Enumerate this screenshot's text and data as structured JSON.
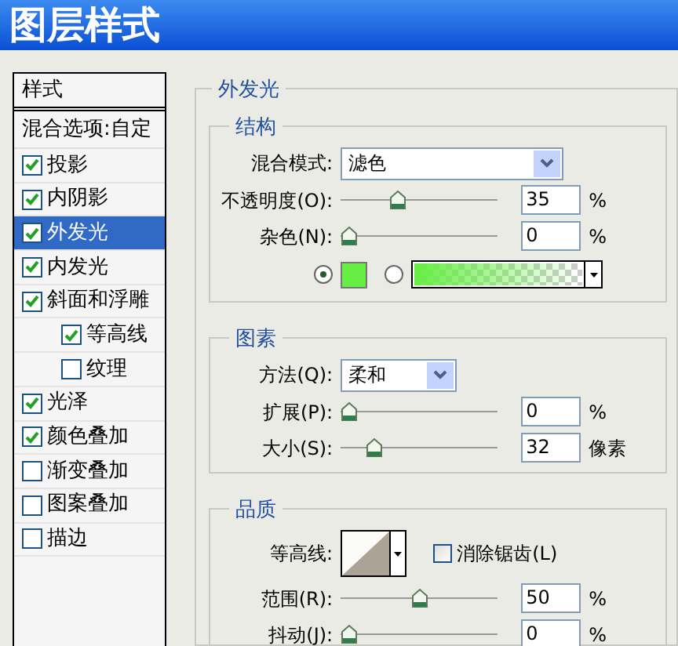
{
  "window": {
    "title": "图层样式"
  },
  "styles_list": {
    "header": "样式",
    "items": [
      {
        "kind": "blend",
        "label": "混合选项:自定",
        "selected": false
      },
      {
        "kind": "check",
        "label": "投影",
        "checked": true,
        "selected": false
      },
      {
        "kind": "check",
        "label": "内阴影",
        "checked": true,
        "selected": false
      },
      {
        "kind": "check",
        "label": "外发光",
        "checked": true,
        "selected": true
      },
      {
        "kind": "check",
        "label": "内发光",
        "checked": true,
        "selected": false
      },
      {
        "kind": "check",
        "label": "斜面和浮雕",
        "checked": true,
        "selected": false,
        "children": [
          {
            "kind": "check",
            "label": "等高线",
            "checked": true,
            "selected": false
          },
          {
            "kind": "check",
            "label": "纹理",
            "checked": false,
            "selected": false
          }
        ]
      },
      {
        "kind": "check",
        "label": "光泽",
        "checked": true,
        "selected": false
      },
      {
        "kind": "check",
        "label": "颜色叠加",
        "checked": true,
        "selected": false
      },
      {
        "kind": "check",
        "label": "渐变叠加",
        "checked": false,
        "selected": false
      },
      {
        "kind": "check",
        "label": "图案叠加",
        "checked": false,
        "selected": false
      },
      {
        "kind": "check",
        "label": "描边",
        "checked": false,
        "selected": false
      }
    ]
  },
  "panel": {
    "title": "外发光",
    "groups": [
      {
        "title": "结构",
        "rows": [
          {
            "kind": "select",
            "label": "混合模式:",
            "value": "滤色",
            "wide": true
          },
          {
            "kind": "slider",
            "label": "不透明度(O):",
            "level": 0.35,
            "value": "35",
            "unit": "%"
          },
          {
            "kind": "slider",
            "label": "杂色(N):",
            "level": 0,
            "value": "0",
            "unit": "%"
          },
          {
            "kind": "color",
            "solid_selected": true,
            "gradient_selected": false,
            "color": "#66ee44"
          }
        ]
      },
      {
        "title": "图素",
        "rows": [
          {
            "kind": "select",
            "label": "方法(Q):",
            "value": "柔和",
            "wide": false
          },
          {
            "kind": "slider",
            "label": "扩展(P):",
            "level": 0,
            "value": "0",
            "unit": "%"
          },
          {
            "kind": "slider",
            "label": "大小(S):",
            "level": 0.18,
            "value": "32",
            "unit": "像素"
          }
        ]
      },
      {
        "title": "品质",
        "rows": [
          {
            "kind": "contour",
            "label": "等高线:",
            "antialias_label": "消除锯齿(L)",
            "antialias": false
          },
          {
            "kind": "slider",
            "label": "范围(R):",
            "level": 0.5,
            "value": "50",
            "unit": "%"
          },
          {
            "kind": "slider",
            "label": "抖动(J):",
            "level": 0,
            "value": "0",
            "unit": "%"
          }
        ]
      }
    ]
  }
}
